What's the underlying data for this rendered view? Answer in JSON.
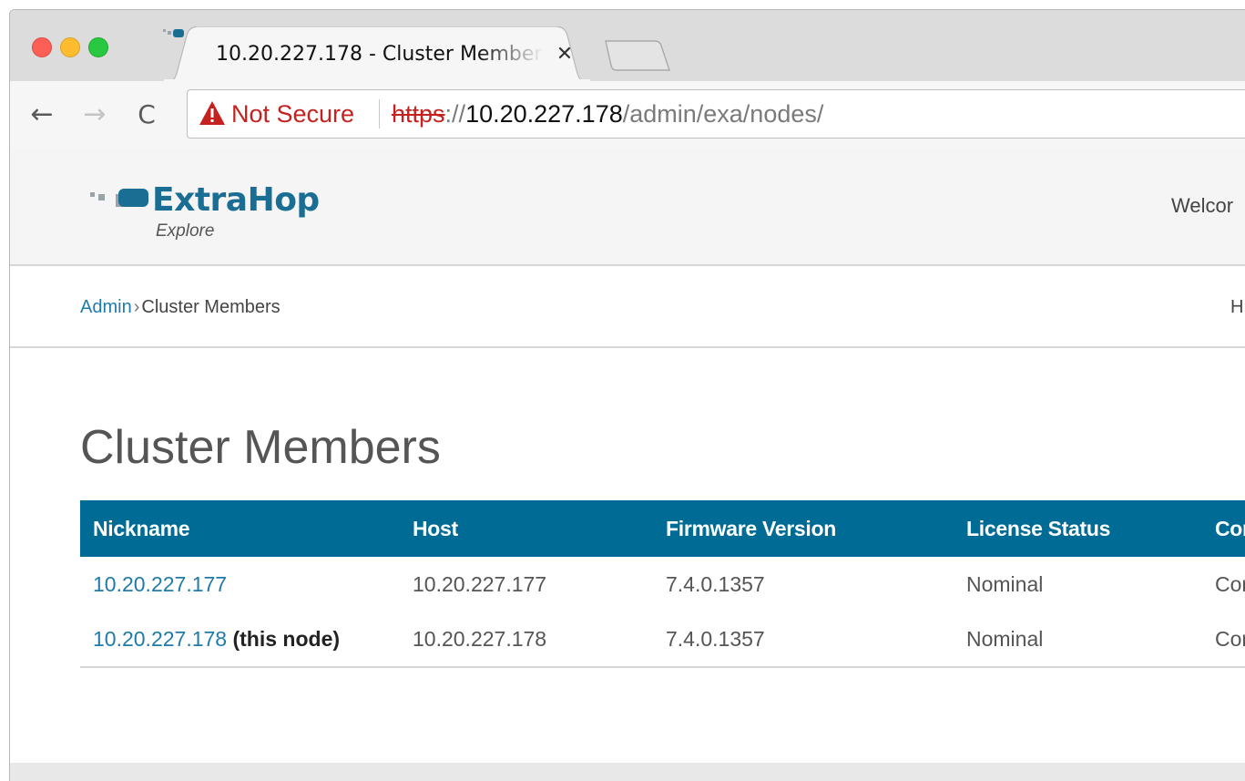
{
  "browser": {
    "tab": {
      "title": "10.20.227.178 - Cluster Members",
      "close_glyph": "✕",
      "favicon": "extrahop-favicon"
    },
    "nav": {
      "back_glyph": "←",
      "forward_glyph": "→",
      "reload_glyph": "C"
    },
    "address": {
      "security_label": "Not Secure",
      "scheme": "https",
      "separator": "://",
      "host": "10.20.227.178",
      "path": "/admin/exa/nodes/"
    }
  },
  "header": {
    "logo_text": "ExtraHop",
    "logo_subtitle": "Explore",
    "welcome_text": "Welcor"
  },
  "breadcrumb": {
    "root": "Admin",
    "separator": "›",
    "current": "Cluster Members",
    "right_text": "H"
  },
  "main": {
    "title": "Cluster Members",
    "table": {
      "columns": [
        "Nickname",
        "Host",
        "Firmware Version",
        "License Status",
        "Con"
      ],
      "rows": [
        {
          "nickname": "10.20.227.177",
          "nickname_suffix": "",
          "host": "10.20.227.177",
          "firmware": "7.4.0.1357",
          "license": "Nominal",
          "connection": "Con"
        },
        {
          "nickname": "10.20.227.178",
          "nickname_suffix": "(this node)",
          "host": "10.20.227.178",
          "firmware": "7.4.0.1357",
          "license": "Nominal",
          "connection": "Con"
        }
      ]
    }
  },
  "colors": {
    "table_header": "#006b94",
    "link": "#1f7bab",
    "not_secure": "#c5221f",
    "brand": "#1a6e93"
  }
}
